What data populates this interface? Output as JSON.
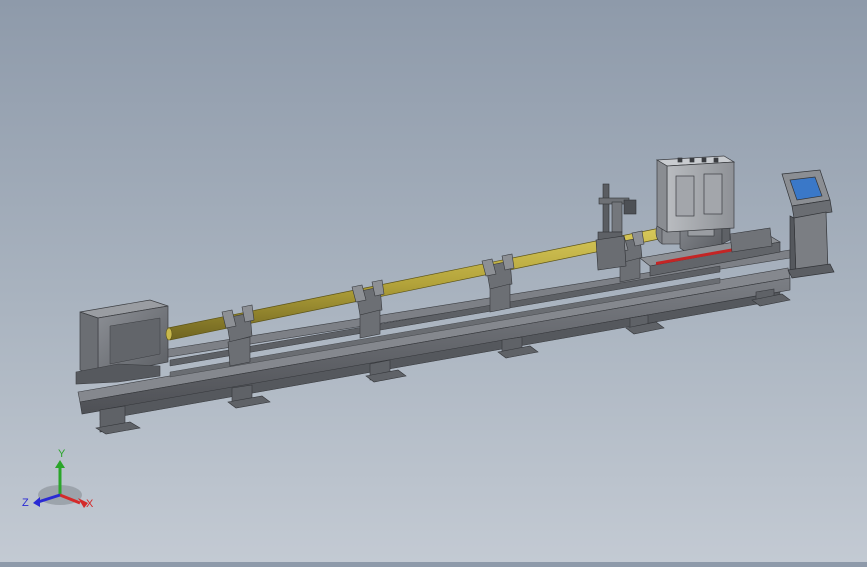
{
  "triad": {
    "x_label": "X",
    "y_label": "Y",
    "z_label": "Z",
    "x_color": "#d42a2a",
    "y_color": "#2aa52a",
    "z_color": "#2a2ad4"
  },
  "colors": {
    "frame": "#62656b",
    "frame_dark": "#45474c",
    "frame_light": "#8a8d93",
    "pipe": "#b8a83a",
    "pipe_dark": "#7f7220",
    "screen": "#3a78c8",
    "accent_red": "#c42525"
  }
}
